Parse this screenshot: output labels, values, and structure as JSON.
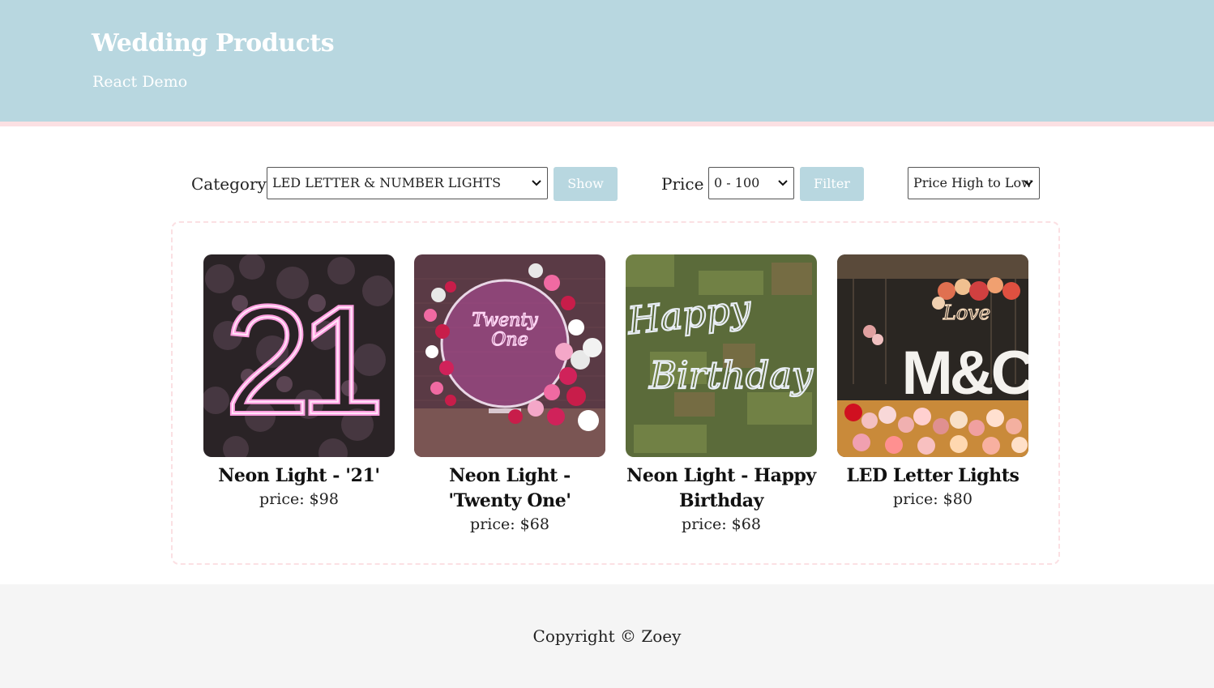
{
  "header": {
    "title": "Wedding Products",
    "subtitle": "React Demo"
  },
  "filters": {
    "category_label": "Category",
    "category_value": "LED LETTER & NUMBER LIGHTS",
    "show_label": "Show",
    "price_label": "Price",
    "price_value": "0 - 100",
    "filter_label": "Filter",
    "sort_value": "Price High to Low"
  },
  "products": [
    {
      "name": "Neon Light - '21'",
      "price": "price: $98"
    },
    {
      "name": "Neon Light - 'Twenty One'",
      "price": "price: $68"
    },
    {
      "name": "Neon Light - Happy Birthday",
      "price": "price: $68"
    },
    {
      "name": "LED Letter Lights",
      "price": "price: $80"
    }
  ],
  "photo_text": {
    "p1": "21",
    "p2_line1": "Twenty",
    "p2_line2": "One",
    "p3_line1": "Happy",
    "p3_line2": "Birthday",
    "p4_line1": "Love",
    "p4_line2": "M&C"
  },
  "footer": {
    "copyright": "Copyright © Zoey"
  },
  "colors": {
    "header_bg": "#b8d7e0",
    "accent_pink": "#fbe0e3",
    "button_bg": "#b8d7e0",
    "footer_bg": "#f5f5f5"
  }
}
